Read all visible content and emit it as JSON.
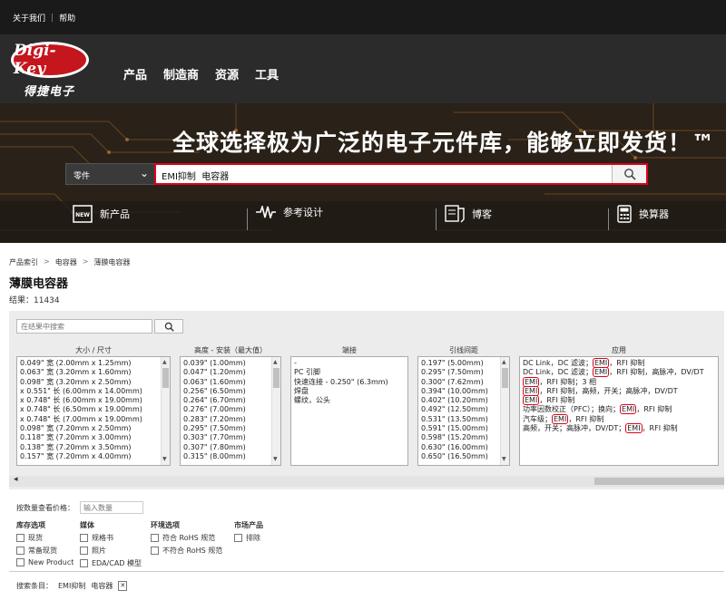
{
  "header": {
    "top_links": [
      "关于我们",
      "帮助"
    ],
    "top_separator": "|",
    "logo_text": "Digi-Key",
    "logo_subtitle": "得捷电子",
    "nav": [
      "产品",
      "制造商",
      "资源",
      "工具"
    ]
  },
  "hero": {
    "title": "全球选择极为广泛的电子元件库，能够立即发货！™",
    "search_category": "零件",
    "search_value": "EMI抑制  电容器",
    "quick_links": [
      {
        "label": "新产品",
        "icon": "new-badge-icon"
      },
      {
        "label": "参考设计",
        "icon": "waveform-icon"
      },
      {
        "label": "博客",
        "icon": "blog-icon"
      },
      {
        "label": "换算器",
        "icon": "calculator-icon"
      }
    ]
  },
  "breadcrumb": [
    "产品索引",
    "电容器",
    "薄膜电容器"
  ],
  "breadcrumb_separator": ">",
  "page_title": "薄膜电容器",
  "results_text": "结果：11434",
  "filters": {
    "search_within_placeholder": "在结果中搜索",
    "columns": [
      {
        "header": "大小 / 尺寸",
        "options": [
          "0.049\" 宽 (2.00mm x 1.25mm)",
          "0.063\" 宽 (3.20mm x 1.60mm)",
          "0.098\" 宽 (3.20mm x 2.50mm)",
          "x 0.551\" 长 (6.00mm x 14.00mm)",
          "x 0.748\" 长 (6.00mm x 19.00mm)",
          "x 0.748\" 长 (6.50mm x 19.00mm)",
          "x 0.748\" 长 (7.00mm x 19.00mm)",
          "0.098\" 宽 (7.20mm x 2.50mm)",
          "0.118\" 宽 (7.20mm x 3.00mm)",
          "0.138\" 宽 (7.20mm x 3.50mm)",
          "0.157\" 宽 (7.20mm x 4.00mm)"
        ]
      },
      {
        "header": "高度 - 安装（最大值）",
        "options": [
          "0.039\" (1.00mm)",
          "0.047\" (1.20mm)",
          "0.063\" (1.60mm)",
          "0.256\" (6.50mm)",
          "0.264\" (6.70mm)",
          "0.276\" (7.00mm)",
          "0.283\" (7.20mm)",
          "0.295\" (7.50mm)",
          "0.303\" (7.70mm)",
          "0.307\" (7.80mm)",
          "0.315\" (8.00mm)"
        ]
      },
      {
        "header": "端接",
        "options": [
          "-",
          "PC 引脚",
          "快速连接 - 0.250\" (6.3mm)",
          "焊盘",
          "螺纹，公头"
        ]
      },
      {
        "header": "引线间距",
        "options": [
          "0.197\" (5.00mm)",
          "0.295\" (7.50mm)",
          "0.300\" (7.62mm)",
          "0.394\" (10.00mm)",
          "0.402\" (10.20mm)",
          "0.492\" (12.50mm)",
          "0.531\" (13.50mm)",
          "0.591\" (15.00mm)",
          "0.598\" (15.20mm)",
          "0.630\" (16.00mm)",
          "0.650\" (16.50mm)"
        ]
      },
      {
        "header": "应用",
        "options": [
          "DC Link，DC 滤波；EMI，RFI 抑制",
          "DC Link，DC 滤波；EMI，RFI 抑制，高脉冲，DV/DT",
          "EMI，RFI 抑制；3 相",
          "EMI，RFI 抑制，高频，开关；高脉冲，DV/DT",
          "EMI，RFI 抑制",
          "功率因数校正（PFC）；换向；EMI，RFI 抑制",
          "汽车级；EMI，RFI 抑制",
          "高频，开关；高脉冲，DV/DT；EMI，RFI 抑制"
        ]
      }
    ]
  },
  "quantity": {
    "label": "按数量查看价格：",
    "placeholder": "输入数量"
  },
  "option_groups": [
    {
      "title": "库存选项",
      "items": [
        "现货",
        "常备现货",
        "New Product"
      ]
    },
    {
      "title": "媒体",
      "items": [
        "规格书",
        "照片",
        "EDA/CAD 模型"
      ]
    },
    {
      "title": "环境选项",
      "items": [
        "符合 RoHS 规范",
        "不符合 RoHS 规范"
      ]
    },
    {
      "title": "市场产品",
      "items": [
        "排除"
      ]
    }
  ],
  "applied_filters": {
    "label": "搜索条目：",
    "terms": [
      "EMI抑制",
      "电容器"
    ],
    "remove_glyph": "✕"
  },
  "colors": {
    "accent_red": "#e0001b",
    "brand_red": "#c4161c",
    "header_bg": "#1a1a1a"
  }
}
